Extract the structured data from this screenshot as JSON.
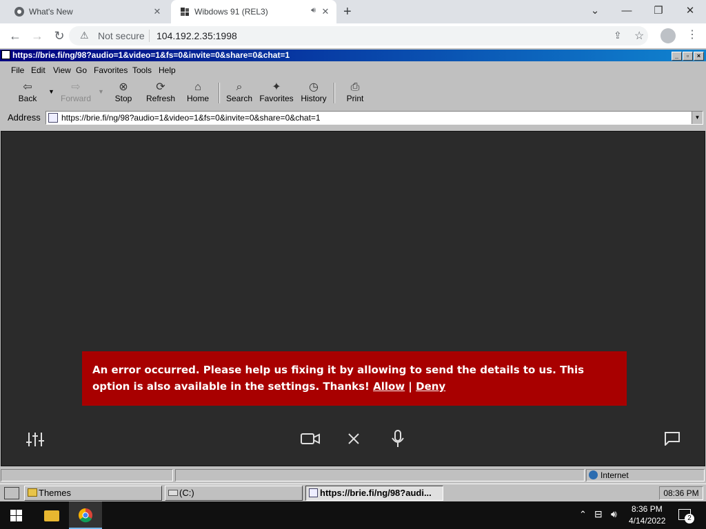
{
  "chrome": {
    "tabs": [
      {
        "title": "What's New"
      },
      {
        "title": "Wibdows 91 (REL3)"
      }
    ],
    "new_tab": "+",
    "security_label": "Not secure",
    "url": "104.192.2.35:1998"
  },
  "ie": {
    "title": "https://brie.fi/ng/98?audio=1&video=1&fs=0&invite=0&share=0&chat=1",
    "menu": [
      "File",
      "Edit",
      "View",
      "Go",
      "Favorites",
      "Tools",
      "Help"
    ],
    "toolbar": {
      "back": "Back",
      "forward": "Forward",
      "stop": "Stop",
      "refresh": "Refresh",
      "home": "Home",
      "search": "Search",
      "favorites": "Favorites",
      "history": "History",
      "print": "Print"
    },
    "address_label": "Address",
    "address_value": "https://brie.fi/ng/98?audio=1&video=1&fs=0&invite=0&share=0&chat=1",
    "status_zone": "Internet"
  },
  "page": {
    "error_text": "An error occurred. Please help us fixing it by allowing to send the details to us. This option is also available in the settings. Thanks!",
    "allow": "Allow",
    "sep": "|",
    "deny": "Deny"
  },
  "w91_taskbar": {
    "items": [
      "Themes",
      "(C:)",
      "https://brie.fi/ng/98?audi..."
    ],
    "clock": "08:36 PM"
  },
  "win_taskbar": {
    "time": "8:36 PM",
    "date": "4/14/2022",
    "notifications": "2"
  }
}
